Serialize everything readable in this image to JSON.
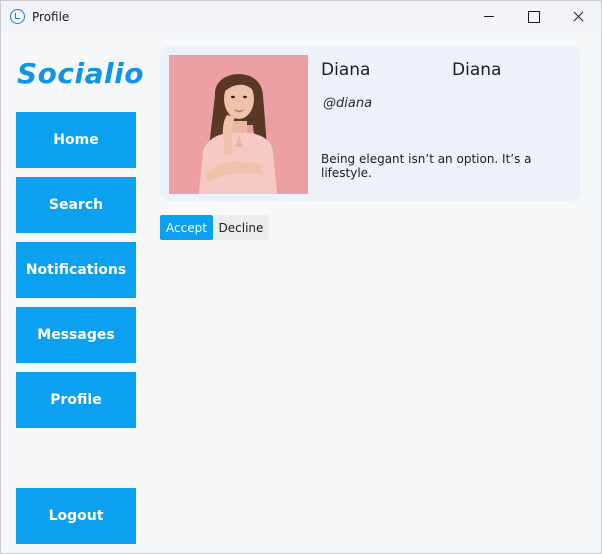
{
  "window": {
    "title": "Profile",
    "icon": "app-logo-icon",
    "controls": [
      "minimize-icon",
      "maximize-icon",
      "close-icon"
    ]
  },
  "sidebar": {
    "logo": "Socialio",
    "items": [
      {
        "label": "Home"
      },
      {
        "label": "Search"
      },
      {
        "label": "Notifications"
      },
      {
        "label": "Messages"
      },
      {
        "label": "Profile"
      }
    ],
    "logout_label": "Logout"
  },
  "profile": {
    "first_name": "Diana",
    "last_name": "Diana",
    "handle": "@diana",
    "bio": "Being elegant isn’t an option. It’s a lifestyle.",
    "photo": "profile-photo"
  },
  "actions": {
    "accept_label": "Accept",
    "decline_label": "Decline"
  },
  "colors": {
    "accent": "#0ba0f0",
    "logo": "#1193e6",
    "card_background": "#edf2fa",
    "window_background": "#f7f8fa"
  }
}
